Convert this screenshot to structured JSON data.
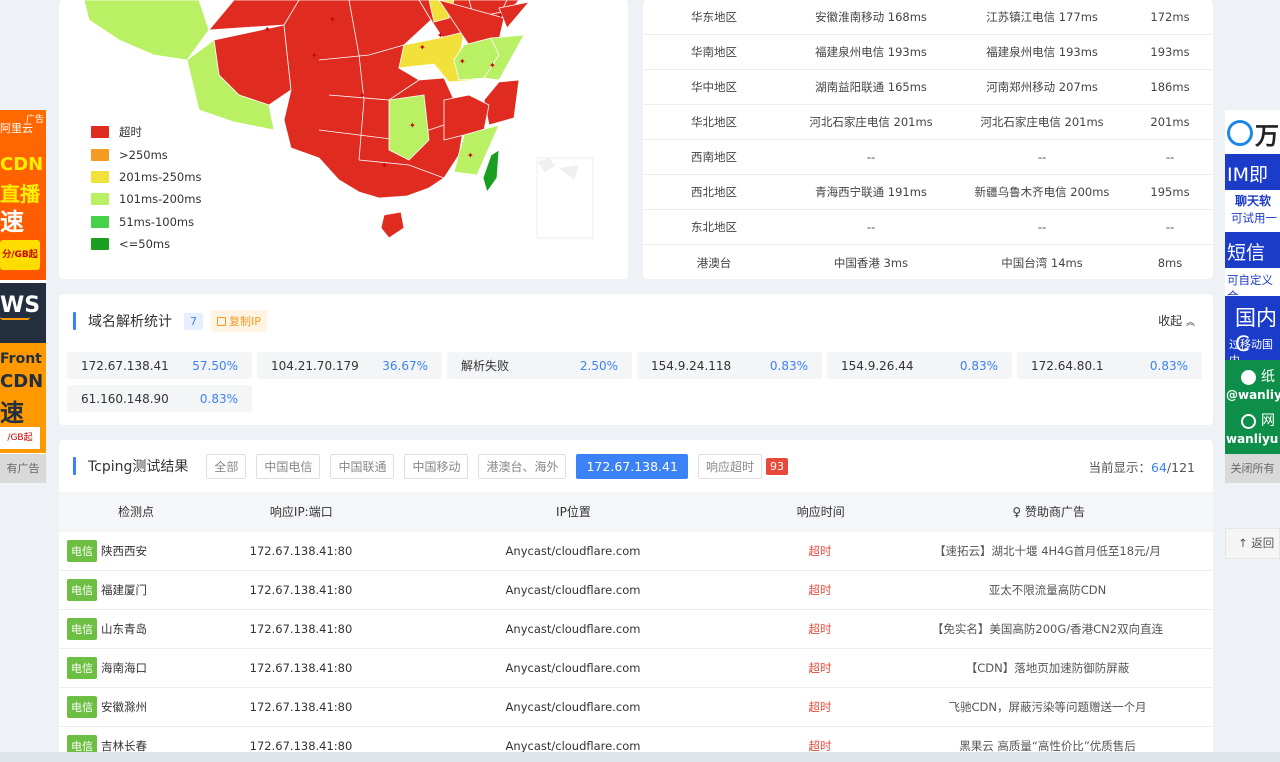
{
  "left_ad": {
    "badge": "广告",
    "brand": "阿里云",
    "line1": "CDN",
    "line2": "直播",
    "line3": "速",
    "price": "分/GB起",
    "aws": "WS",
    "front": "Front",
    "cdn": "CDN",
    "speed": "速",
    "price2": "/GB起",
    "close": "有广告"
  },
  "right_ad": {
    "brand": "万",
    "line1": "IM即时",
    "line2": "聊天软",
    "line3": "可试用一",
    "line4": "短信验",
    "line5": "可自定义合",
    "line6": "国内C",
    "line7": "过移动国内",
    "tg": "纸",
    "handle": "@wanliyu",
    "web": "网",
    "handle2": "wanliyu",
    "close": "关闭所有"
  },
  "legend": [
    {
      "label": "超时",
      "color": "#e02b20"
    },
    {
      "label": ">250ms",
      "color": "#f59a23"
    },
    {
      "label": "201ms-250ms",
      "color": "#f3e13b"
    },
    {
      "label": "101ms-200ms",
      "color": "#b9f064"
    },
    {
      "label": "51ms-100ms",
      "color": "#45d24a"
    },
    {
      "label": "<=50ms",
      "color": "#1a9e20"
    }
  ],
  "regions": [
    {
      "name": "华东地区",
      "fast": "安徽淮南移动 168ms",
      "slow": "江苏镇江电信 177ms",
      "avg": "172ms"
    },
    {
      "name": "华南地区",
      "fast": "福建泉州电信 193ms",
      "slow": "福建泉州电信 193ms",
      "avg": "193ms"
    },
    {
      "name": "华中地区",
      "fast": "湖南益阳联通 165ms",
      "slow": "河南郑州移动 207ms",
      "avg": "186ms"
    },
    {
      "name": "华北地区",
      "fast": "河北石家庄电信 201ms",
      "slow": "河北石家庄电信 201ms",
      "avg": "201ms"
    },
    {
      "name": "西南地区",
      "fast": "--",
      "slow": "--",
      "avg": "--"
    },
    {
      "name": "西北地区",
      "fast": "青海西宁联通 191ms",
      "slow": "新疆乌鲁木齐电信 200ms",
      "avg": "195ms"
    },
    {
      "name": "东北地区",
      "fast": "--",
      "slow": "--",
      "avg": "--"
    },
    {
      "name": "港澳台",
      "fast": "中国香港 3ms",
      "slow": "中国台湾 14ms",
      "avg": "8ms"
    }
  ],
  "dns": {
    "title": "域名解析统计",
    "count": "7",
    "copy_label": "复制IP",
    "collapse_label": "收起",
    "entries": [
      {
        "ip": "172.67.138.41",
        "pct": "57.50%"
      },
      {
        "ip": "104.21.70.179",
        "pct": "36.67%"
      },
      {
        "ip": "解析失败",
        "pct": "2.50%"
      },
      {
        "ip": "154.9.24.118",
        "pct": "0.83%"
      },
      {
        "ip": "154.9.26.44",
        "pct": "0.83%"
      },
      {
        "ip": "172.64.80.1",
        "pct": "0.83%"
      },
      {
        "ip": "61.160.148.90",
        "pct": "0.83%"
      }
    ]
  },
  "tcping": {
    "title": "Tcping测试结果",
    "filters": [
      "全部",
      "中国电信",
      "中国联通",
      "中国移动",
      "港澳台、海外"
    ],
    "active_filter": "172.67.138.41",
    "timeout_filter": "响应超时",
    "timeout_count": "93",
    "shown_label": "当前显示：",
    "shown_num": "64",
    "shown_total": "/121",
    "headers": [
      "检测点",
      "响应IP:端口",
      "IP位置",
      "响应时间",
      "赞助商广告"
    ],
    "rows": [
      {
        "isp": "电信",
        "loc": "陕西西安",
        "ip": "172.67.138.41:80",
        "pos": "Anycast/cloudflare.com",
        "time": "超时",
        "ad": "【速拓云】湖北十堰 4H4G首月低至18元/月"
      },
      {
        "isp": "电信",
        "loc": "福建厦门",
        "ip": "172.67.138.41:80",
        "pos": "Anycast/cloudflare.com",
        "time": "超时",
        "ad": "亚太不限流量高防CDN"
      },
      {
        "isp": "电信",
        "loc": "山东青岛",
        "ip": "172.67.138.41:80",
        "pos": "Anycast/cloudflare.com",
        "time": "超时",
        "ad": "【免实名】美国高防200G/香港CN2双向直连"
      },
      {
        "isp": "电信",
        "loc": "海南海口",
        "ip": "172.67.138.41:80",
        "pos": "Anycast/cloudflare.com",
        "time": "超时",
        "ad": "【CDN】落地页加速防御防屏蔽"
      },
      {
        "isp": "电信",
        "loc": "安徽滁州",
        "ip": "172.67.138.41:80",
        "pos": "Anycast/cloudflare.com",
        "time": "超时",
        "ad": "飞驰CDN，屏蔽污染等问题赠送一个月"
      },
      {
        "isp": "电信",
        "loc": "吉林长春",
        "ip": "172.67.138.41:80",
        "pos": "Anycast/cloudflare.com",
        "time": "超时",
        "ad": "黑果云 高质量“高性价比”优质售后"
      }
    ]
  },
  "back_top": "返回"
}
